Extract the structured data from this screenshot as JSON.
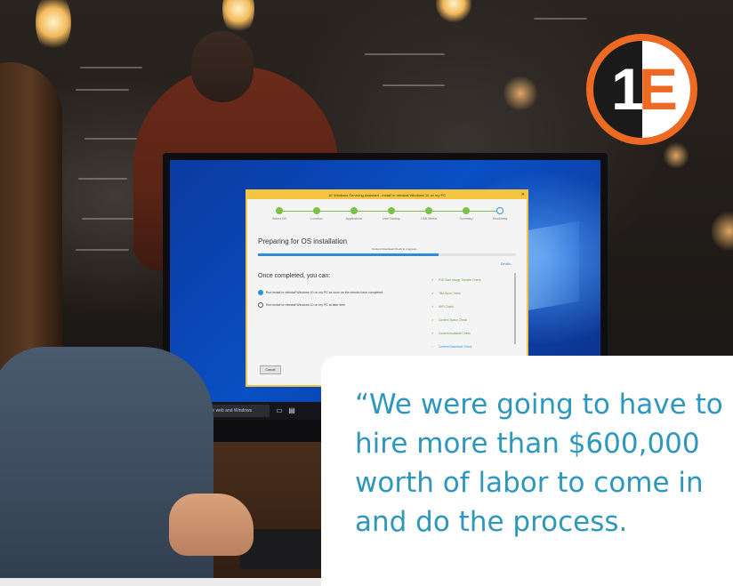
{
  "monitor": {
    "window_title": "1E Windows Servicing Assistant - Install or reinstall Windows 10 on my PC",
    "window_close": "✕",
    "steps": [
      "Select OS",
      "Location",
      "Applications",
      "User Backup",
      "USB Media",
      "Summary",
      "Readiness"
    ],
    "heading": "Preparing for OS installation",
    "progress_label": "Content Download Check in progress...",
    "progress": 0.7,
    "details_link": "Details...",
    "subheading": "Once completed, you can:",
    "options": [
      {
        "label": "Run install or reinstall Windows 10 on my PC as soon as the checks have completed",
        "selected": true
      },
      {
        "label": "Run install or reinstall Windows 10 on my PC at later time",
        "selected": false
      }
    ],
    "checks": [
      "PXE Boot Image Transfer Check",
      "TBA Sync Check",
      "WiFi Check",
      "Content Space Check",
      "Content Available Check",
      "Content Download Check"
    ],
    "cancel_label": "Cancel",
    "taskbar_search": "Search the web and Windows"
  },
  "logo": {
    "one": "1",
    "e": "E"
  },
  "quote": {
    "text": "“We were going to have to hire more than $600,000 worth of labor to come in and do the process."
  },
  "colors": {
    "accent": "#2e97bd",
    "logo_orange": "#ee6a22",
    "dialog_border": "#f5c542"
  },
  "icons": [
    "windows-logo-icon",
    "checkmark-icon",
    "radio-icon"
  ]
}
